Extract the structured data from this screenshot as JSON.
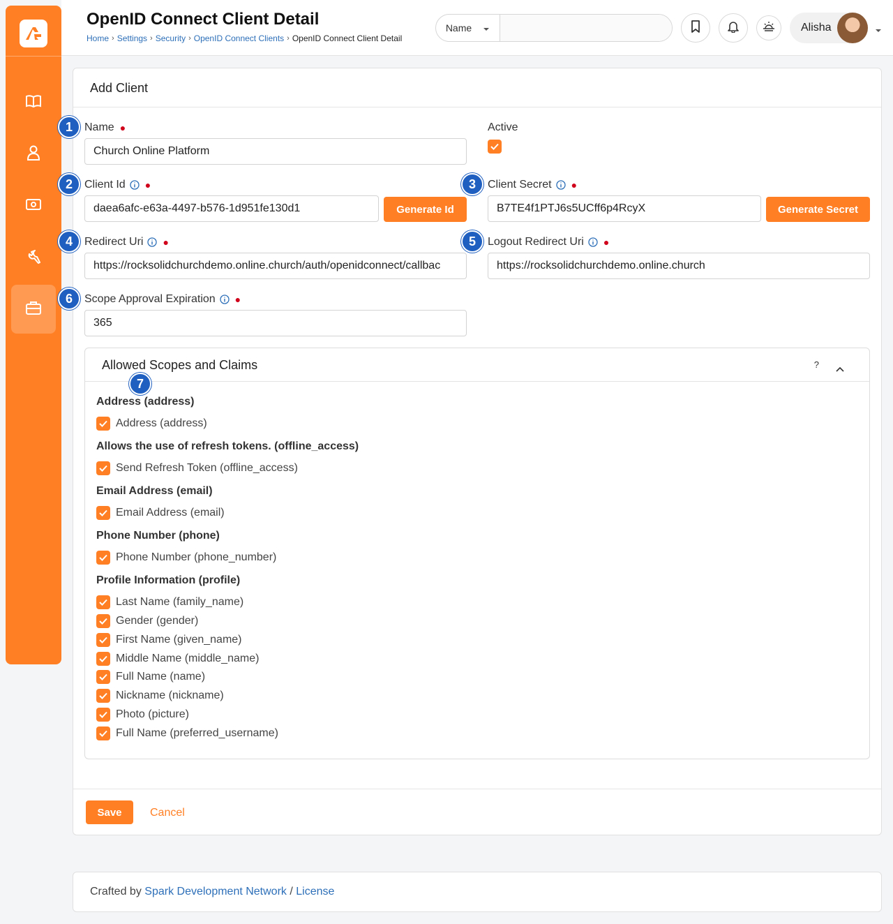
{
  "header": {
    "title": "OpenID Connect Client Detail",
    "breadcrumbs": [
      "Home",
      "Settings",
      "Security",
      "OpenID Connect Clients",
      "OpenID Connect Client Detail"
    ],
    "search_type": "Name",
    "search_placeholder": "",
    "user_name": "Alisha"
  },
  "sidebar": {
    "items": [
      {
        "icon": "book-icon"
      },
      {
        "icon": "person-icon"
      },
      {
        "icon": "money-icon"
      },
      {
        "icon": "wrench-icon"
      },
      {
        "icon": "briefcase-icon",
        "active": true
      }
    ]
  },
  "form": {
    "card_title": "Add Client",
    "name_label": "Name",
    "name_value": "Church Online Platform",
    "active_label": "Active",
    "client_id_label": "Client Id",
    "client_id_value": "daea6afc-e63a-4497-b576-1d951fe130d1",
    "generate_id_label": "Generate Id",
    "client_secret_label": "Client Secret",
    "client_secret_value": "B7TE4f1PTJ6s5UCff6p4RcyX",
    "generate_secret_label": "Generate Secret",
    "redirect_uri_label": "Redirect Uri",
    "redirect_uri_value": "https://rocksolidchurchdemo.online.church/auth/openidconnect/callbac",
    "logout_redirect_uri_label": "Logout Redirect Uri",
    "logout_redirect_uri_value": "https://rocksolidchurchdemo.online.church",
    "scope_expiration_label": "Scope Approval Expiration",
    "scope_expiration_value": "365"
  },
  "scopes": {
    "title": "Allowed Scopes and Claims",
    "help": "?",
    "groups": [
      {
        "title": "Address (address)",
        "items": [
          "Address (address)"
        ]
      },
      {
        "title": "Allows the use of refresh tokens. (offline_access)",
        "items": [
          "Send Refresh Token (offline_access)"
        ]
      },
      {
        "title": "Email Address (email)",
        "items": [
          "Email Address (email)"
        ]
      },
      {
        "title": "Phone Number (phone)",
        "items": [
          "Phone Number (phone_number)"
        ]
      },
      {
        "title": "Profile Information (profile)",
        "items": [
          "Last Name (family_name)",
          "Gender (gender)",
          "First Name (given_name)",
          "Middle Name (middle_name)",
          "Full Name (name)",
          "Nickname (nickname)",
          "Photo (picture)",
          "Full Name (preferred_username)"
        ]
      }
    ]
  },
  "actions": {
    "save": "Save",
    "cancel": "Cancel"
  },
  "badges": [
    "1",
    "2",
    "3",
    "4",
    "5",
    "6",
    "7"
  ],
  "footer": {
    "prefix": "Crafted by",
    "link1": "Spark Development Network",
    "sep": "/",
    "link2": "License"
  },
  "colors": {
    "accent": "#ff7f24",
    "badge": "#1f5fbf",
    "link": "#2d6fb8"
  }
}
